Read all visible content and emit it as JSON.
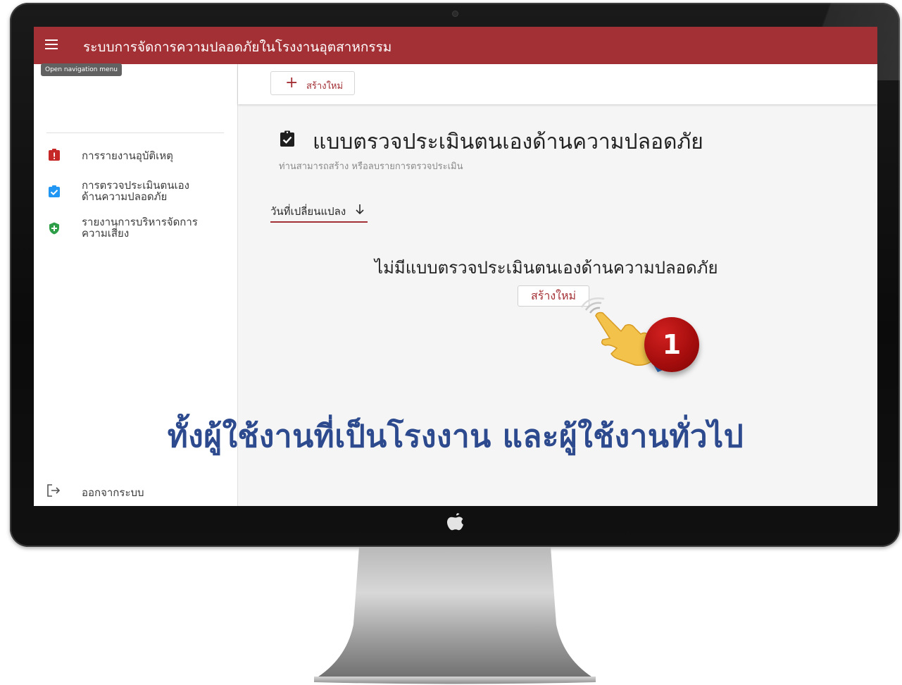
{
  "app": {
    "title": "ระบบการจัดการความปลอดภัยในโรงงานอุตสาหกรรม",
    "menu_tooltip": "Open navigation menu",
    "accent_color": "#a33035"
  },
  "sidebar": {
    "items": [
      {
        "label": "การรายงานอุบัติเหตุ",
        "icon": "report-alert-icon",
        "color": "#c62828"
      },
      {
        "label_line1": "การตรวจประเมินตนเอง",
        "label_line2": "ด้านความปลอดภัย",
        "icon": "clipboard-check-icon",
        "color": "#2196f3"
      },
      {
        "label_line1": "รายงานการบริหารจัดการ",
        "label_line2": "ความเสี่ยง",
        "icon": "shield-plus-icon",
        "color": "#2e9e48"
      }
    ],
    "logout_label": "ออกจากระบบ"
  },
  "toolbar": {
    "new_button_label": "สร้างใหม่"
  },
  "main": {
    "title": "แบบตรวจประเมินตนเองด้านความปลอดภัย",
    "subtitle": "ท่านสามารถสร้าง หรือลบรายการตรวจประเมิน",
    "sort_label": "วันที่เปลี่ยนแปลง",
    "empty_message": "ไม่มีแบบตรวจประเมินตนเองด้านความปลอดภัย",
    "empty_new_button": "สร้างใหม่"
  },
  "overlay": {
    "step_number": "1",
    "caption": "ทั้งผู้ใช้งานที่เป็นโรงงาน และผู้ใช้งานทั่วไป"
  }
}
